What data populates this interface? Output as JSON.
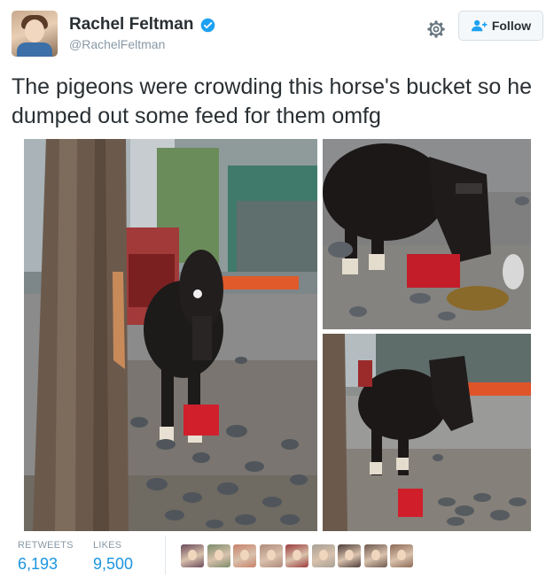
{
  "user": {
    "display_name": "Rachel Feltman",
    "handle": "@RachelFeltman",
    "verified_icon": "verified-badge-icon",
    "avatar_icon": "profile-avatar"
  },
  "actions": {
    "settings_icon": "gear-icon",
    "follow_label": "Follow",
    "follow_icon": "add-user-icon"
  },
  "tweet": {
    "text": "The pigeons were crowding this horse's bucket so he dumped out some feed for them omfg"
  },
  "stats": {
    "retweets_label": "RETWEETS",
    "retweets_value": "6,193",
    "likes_label": "LIKES",
    "likes_value": "9,500"
  },
  "colors": {
    "link_blue": "#1b95e0",
    "muted_gray": "#8899a6",
    "text_dark": "#292f33",
    "border": "#e1e8ed"
  },
  "likers": [
    {
      "color": "#6b4b5a"
    },
    {
      "color": "#7a8c6a"
    },
    {
      "color": "#c8826a"
    },
    {
      "color": "#b08a7c"
    },
    {
      "color": "#9c3c3c"
    },
    {
      "color": "#a8a095"
    },
    {
      "color": "#4d3d3a"
    },
    {
      "color": "#6f5a4f"
    },
    {
      "color": "#8c6a55"
    }
  ]
}
